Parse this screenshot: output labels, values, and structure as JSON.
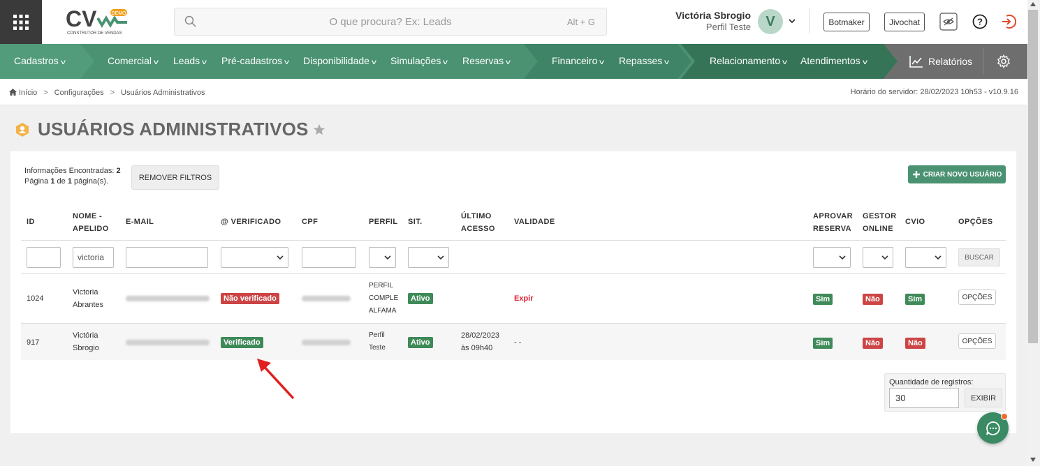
{
  "header": {
    "logo_text": "CV",
    "logo_badge": "DEMO",
    "logo_sub": "CONSTRUTOR DE VENDAS",
    "search_placeholder": "O que procura? Ex: Leads",
    "search_shortcut": "Alt + G",
    "user_name": "Victória Sbrogio",
    "user_role": "Perfil Teste",
    "avatar_letter": "V",
    "btn_botmaker": "Botmaker",
    "btn_jivochat": "Jivochat"
  },
  "nav": {
    "items": [
      "Cadastros",
      "Comercial",
      "Leads",
      "Pré-cadastros",
      "Disponibilidade",
      "Simulações",
      "Reservas",
      "Financeiro",
      "Repasses",
      "Relacionamento",
      "Atendimentos"
    ],
    "reports": "Relatórios"
  },
  "breadcrumb": {
    "items": [
      "Início",
      "Configurações",
      "Usuários Administrativos"
    ],
    "server_time": "Horário do servidor: 28/02/2023 10h53 - v10.9.16"
  },
  "page": {
    "title": "USUÁRIOS ADMINISTRATIVOS"
  },
  "toolbar": {
    "found_label": "Informações Encontradas:",
    "found_count": "2",
    "page_word": "Página",
    "page_current": "1",
    "page_of": "de",
    "page_total": "1",
    "page_suffix": "página(s).",
    "remove_filters": "REMOVER FILTROS",
    "new_user": "CRIAR NOVO USUÁRIO"
  },
  "table": {
    "headers": {
      "id": "ID",
      "nome1": "NOME -",
      "nome2": "APELIDO",
      "email": "E-MAIL",
      "verificado": "@ VERIFICADO",
      "cpf": "CPF",
      "perfil": "PERFIL",
      "sit": "SIT.",
      "ultimo1": "ÚLTIMO",
      "ultimo2": "ACESSO",
      "validade": "VALIDADE",
      "aprovar1": "APROVAR",
      "aprovar2": "RESERVA",
      "gestor1": "GESTOR",
      "gestor2": "ONLINE",
      "cvio": "CVIO",
      "opcoes": "OPÇÕES"
    },
    "filters": {
      "nome_value": "victoria",
      "buscar": "BUSCAR"
    },
    "rows": [
      {
        "id": "1024",
        "nome1": "Victoria",
        "nome2": "Abrantes",
        "verificado": "Não verificado",
        "perfil1": "PERFIL",
        "perfil2": "COMPLE",
        "perfil3": "ALFAMA",
        "sit": "Ativo",
        "ultimo1": "",
        "ultimo2": "",
        "validade": "Expir",
        "aprovar": "Sim",
        "gestor": "Não",
        "cvio": "Sim",
        "opcoes": "OPÇÕES"
      },
      {
        "id": "917",
        "nome1": "Victória",
        "nome2": "Sbrogio",
        "verificado": "Verificado",
        "perfil1": "Perfil",
        "perfil2": "Teste",
        "sit": "Ativo",
        "ultimo1": "28/02/2023",
        "ultimo2": "às 09h40",
        "validade": "- -",
        "aprovar": "Sim",
        "gestor": "Não",
        "cvio": "Não",
        "opcoes": "OPÇÕES"
      }
    ]
  },
  "pagination": {
    "qty_label": "Quantidade de registros:",
    "qty_value": "30",
    "show": "EXIBIR"
  },
  "colors": {
    "brand_green": "#4a9272",
    "badge_green": "#3e8a58",
    "badge_red": "#cc4444",
    "annotation_arrow": "#e02020"
  }
}
